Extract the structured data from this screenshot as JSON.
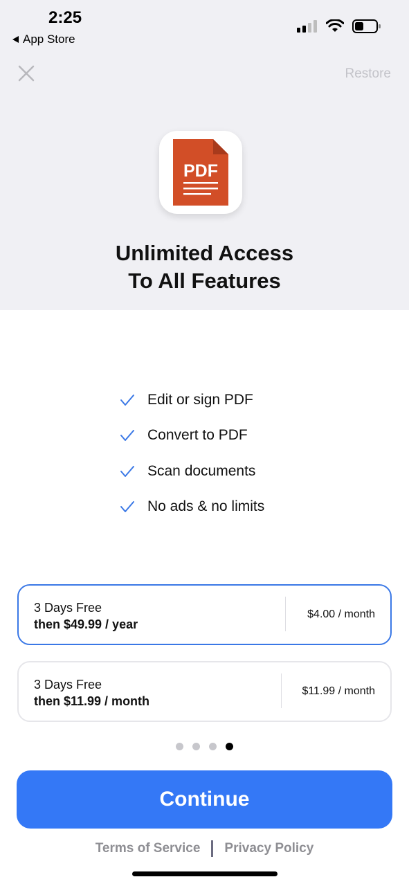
{
  "status_bar": {
    "time": "2:25",
    "back_label": "App Store",
    "icons": [
      "cellular-signal-icon",
      "wifi-icon",
      "battery-icon"
    ]
  },
  "header": {
    "close_icon": "close-icon",
    "restore_label": "Restore"
  },
  "app_icon": {
    "label": "PDF",
    "color": "#D24E27"
  },
  "headline": {
    "line1": "Unlimited Access",
    "line2": "To All Features"
  },
  "features": [
    {
      "label": "Edit or sign PDF"
    },
    {
      "label": "Convert to PDF"
    },
    {
      "label": "Scan documents"
    },
    {
      "label": "No ads & no limits"
    }
  ],
  "plans": [
    {
      "trial": "3 Days Free",
      "terms": "then $49.99 / year",
      "price": "$4.00 / month",
      "selected": true
    },
    {
      "trial": "3 Days Free",
      "terms": "then $11.99 / month",
      "price": "$11.99 / month",
      "selected": false
    }
  ],
  "page_indicator": {
    "count": 4,
    "active_index": 3
  },
  "continue_label": "Continue",
  "footer": {
    "terms_label": "Terms of Service",
    "privacy_label": "Privacy Policy"
  },
  "colors": {
    "accent": "#3478F6",
    "selected_border": "#3A78E6",
    "top_background": "#F0F0F4",
    "check": "#3A78E6"
  }
}
